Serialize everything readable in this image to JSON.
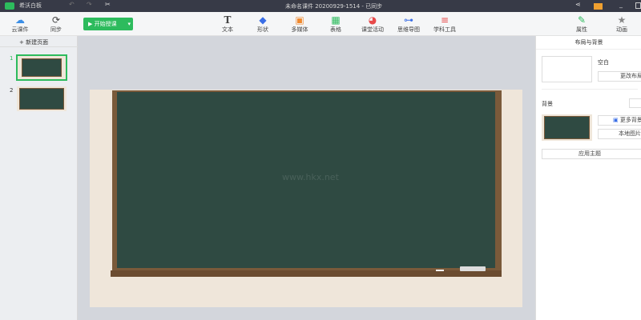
{
  "titlebar": {
    "app_name": "希沃白板",
    "doc_title": "未命名课件 20200929-1514 - 已同步"
  },
  "toolbar": {
    "cloud": "云课件",
    "sync": "同步",
    "start": "开始授课",
    "tools": [
      {
        "label": "文本",
        "icon": "text-icon"
      },
      {
        "label": "形状",
        "icon": "shape-icon"
      },
      {
        "label": "多媒体",
        "icon": "media-icon"
      },
      {
        "label": "表格",
        "icon": "table-icon"
      },
      {
        "label": "课堂活动",
        "icon": "activity-icon"
      },
      {
        "label": "思维导图",
        "icon": "mindmap-icon"
      },
      {
        "label": "学科工具",
        "icon": "subject-tools-icon"
      }
    ],
    "properties": "属性",
    "animation": "动画"
  },
  "left": {
    "new_page": "+ 新建页面",
    "pages": [
      "1",
      "2"
    ]
  },
  "canvas": {
    "watermark": "www.hkx.net"
  },
  "right": {
    "title": "布局与背景",
    "layout_name": "空白",
    "change_layout": "更改布局",
    "background": "背景",
    "more_bg": "更多背景",
    "local_image": "本地图片",
    "apply_theme": "应用主题"
  },
  "colors": {
    "titlebar": "#373a47",
    "accent": "#2dbb5d",
    "board": "#2f4a42",
    "frame": "#7a5a3a"
  }
}
